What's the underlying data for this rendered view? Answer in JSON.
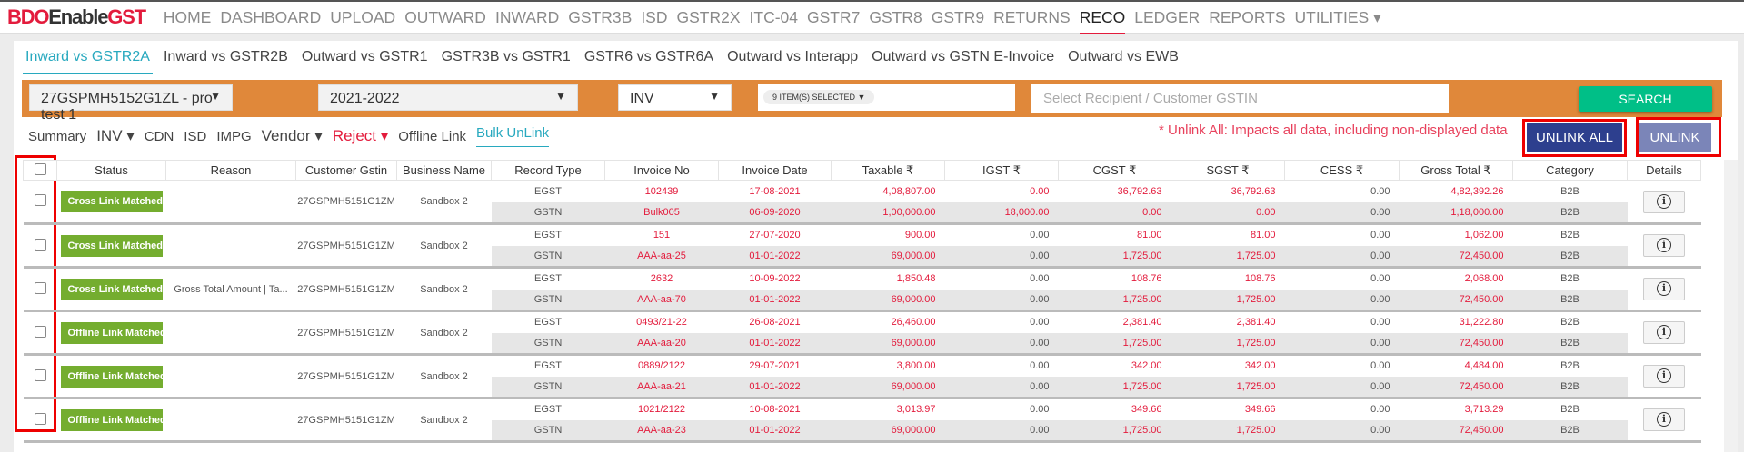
{
  "brand": {
    "part1": "BDO",
    "part2": "Enable",
    "part3": "GST"
  },
  "nav": [
    "HOME",
    "DASHBOARD",
    "UPLOAD",
    "OUTWARD",
    "INWARD",
    "GSTR3B",
    "ISD",
    "GSTR2X",
    "ITC-04",
    "GSTR7",
    "GSTR8",
    "GSTR9",
    "RETURNS",
    "RECO",
    "LEDGER",
    "REPORTS",
    "UTILITIES ▾"
  ],
  "nav_active": "RECO",
  "tabs": [
    "Inward vs GSTR2A",
    "Inward vs GSTR2B",
    "Outward vs GSTR1",
    "GSTR3B vs GSTR1",
    "GSTR6 vs GSTR6A",
    "Outward vs Interapp",
    "Outward vs GSTN E-Invoice",
    "Outward vs EWB"
  ],
  "filters_bar": {
    "gstin": "27GSPMH5152G1ZL - pro test 1",
    "year": "2021-2022",
    "doc_type": "INV",
    "items_selected": "9 ITEM(S) SELECTED",
    "recipient_placeholder": "Select Recipient / Customer GSTIN",
    "search": "SEARCH"
  },
  "subfilters": {
    "summary": "Summary",
    "inv": "INV",
    "cdn": "CDN",
    "isd": "ISD",
    "impg": "IMPG",
    "vendor": "Vendor",
    "reject": "Reject",
    "offline_link": "Offline Link",
    "bulk_unlink": "Bulk UnLink"
  },
  "note": "* Unlink All: Impacts all data, including non-displayed data",
  "buttons": {
    "unlink_all": "UNLINK ALL",
    "unlink": "UNLINK"
  },
  "colors": {
    "red": "#e31b3c",
    "gray": "#555555",
    "green": "#74ad2f"
  },
  "columns": [
    "Status",
    "Reason",
    "Customer Gstin",
    "Business Name",
    "Record Type",
    "Invoice No",
    "Invoice Date",
    "Taxable ₹",
    "IGST ₹",
    "CGST ₹",
    "SGST ₹",
    "CESS ₹",
    "Gross Total ₹",
    "Category",
    "Details"
  ],
  "rows": [
    {
      "status": "Cross Link Matched",
      "reason": "",
      "gstin": "27GSPMH5151G1ZM",
      "business": "Sandbox 2",
      "igst_red": true,
      "egst": {
        "type": "EGST",
        "inv": "102439",
        "date": "17-08-2021",
        "taxable": "4,08,807.00",
        "igst": "0.00",
        "cgst": "36,792.63",
        "sgst": "36,792.63",
        "cess": "0.00",
        "gross": "4,82,392.26",
        "cat": "B2B"
      },
      "gstn": {
        "type": "GSTN",
        "inv": "Bulk005",
        "date": "06-09-2020",
        "taxable": "1,00,000.00",
        "igst": "18,000.00",
        "cgst": "0.00",
        "sgst": "0.00",
        "cess": "0.00",
        "gross": "1,18,000.00",
        "cat": "B2B"
      }
    },
    {
      "status": "Cross Link Matched",
      "reason": "",
      "gstin": "27GSPMH5151G1ZM",
      "business": "Sandbox 2",
      "igst_red": false,
      "egst": {
        "type": "EGST",
        "inv": "151",
        "date": "27-07-2020",
        "taxable": "900.00",
        "igst": "0.00",
        "cgst": "81.00",
        "sgst": "81.00",
        "cess": "0.00",
        "gross": "1,062.00",
        "cat": "B2B"
      },
      "gstn": {
        "type": "GSTN",
        "inv": "AAA-aa-25",
        "date": "01-01-2022",
        "taxable": "69,000.00",
        "igst": "0.00",
        "cgst": "1,725.00",
        "sgst": "1,725.00",
        "cess": "0.00",
        "gross": "72,450.00",
        "cat": "B2B"
      }
    },
    {
      "status": "Cross Link Matched",
      "reason": "Gross Total Amount | Ta...",
      "gstin": "27GSPMH5151G1ZM",
      "business": "Sandbox 2",
      "igst_red": false,
      "egst": {
        "type": "EGST",
        "inv": "2632",
        "date": "10-09-2022",
        "taxable": "1,850.48",
        "igst": "0.00",
        "cgst": "108.76",
        "sgst": "108.76",
        "cess": "0.00",
        "gross": "2,068.00",
        "cat": "B2B"
      },
      "gstn": {
        "type": "GSTN",
        "inv": "AAA-aa-70",
        "date": "01-01-2022",
        "taxable": "69,000.00",
        "igst": "0.00",
        "cgst": "1,725.00",
        "sgst": "1,725.00",
        "cess": "0.00",
        "gross": "72,450.00",
        "cat": "B2B"
      }
    },
    {
      "status": "Offline Link Matched",
      "reason": "",
      "gstin": "27GSPMH5151G1ZM",
      "business": "Sandbox 2",
      "igst_red": false,
      "egst": {
        "type": "EGST",
        "inv": "0493/21-22",
        "date": "26-08-2021",
        "taxable": "26,460.00",
        "igst": "0.00",
        "cgst": "2,381.40",
        "sgst": "2,381.40",
        "cess": "0.00",
        "gross": "31,222.80",
        "cat": "B2B"
      },
      "gstn": {
        "type": "GSTN",
        "inv": "AAA-aa-20",
        "date": "01-01-2022",
        "taxable": "69,000.00",
        "igst": "0.00",
        "cgst": "1,725.00",
        "sgst": "1,725.00",
        "cess": "0.00",
        "gross": "72,450.00",
        "cat": "B2B"
      }
    },
    {
      "status": "Offline Link Matched",
      "reason": "",
      "gstin": "27GSPMH5151G1ZM",
      "business": "Sandbox 2",
      "igst_red": false,
      "egst": {
        "type": "EGST",
        "inv": "0889/2122",
        "date": "29-07-2021",
        "taxable": "3,800.00",
        "igst": "0.00",
        "cgst": "342.00",
        "sgst": "342.00",
        "cess": "0.00",
        "gross": "4,484.00",
        "cat": "B2B"
      },
      "gstn": {
        "type": "GSTN",
        "inv": "AAA-aa-21",
        "date": "01-01-2022",
        "taxable": "69,000.00",
        "igst": "0.00",
        "cgst": "1,725.00",
        "sgst": "1,725.00",
        "cess": "0.00",
        "gross": "72,450.00",
        "cat": "B2B"
      }
    },
    {
      "status": "Offline Link Matched",
      "reason": "",
      "gstin": "27GSPMH5151G1ZM",
      "business": "Sandbox 2",
      "igst_red": false,
      "egst": {
        "type": "EGST",
        "inv": "1021/2122",
        "date": "10-08-2021",
        "taxable": "3,013.97",
        "igst": "0.00",
        "cgst": "349.66",
        "sgst": "349.66",
        "cess": "0.00",
        "gross": "3,713.29",
        "cat": "B2B"
      },
      "gstn": {
        "type": "GSTN",
        "inv": "AAA-aa-23",
        "date": "01-01-2022",
        "taxable": "69,000.00",
        "igst": "0.00",
        "cgst": "1,725.00",
        "sgst": "1,725.00",
        "cess": "0.00",
        "gross": "72,450.00",
        "cat": "B2B"
      }
    }
  ]
}
